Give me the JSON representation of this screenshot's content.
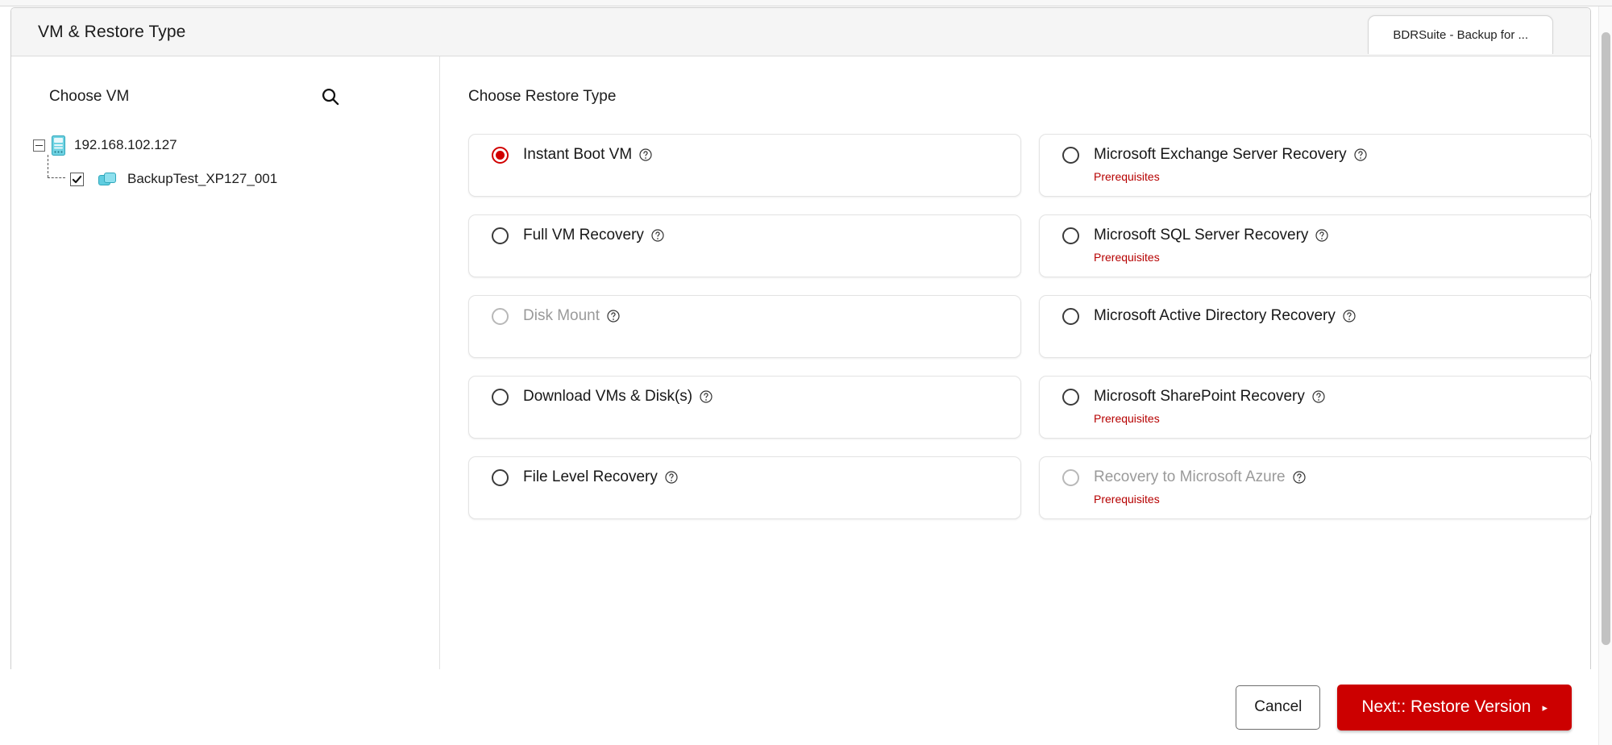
{
  "window": {
    "title": "VM & Restore Type",
    "browser_tab_label": "BDRSuite - Backup for ..."
  },
  "vm_panel": {
    "title": "Choose VM",
    "search_icon": "search-icon",
    "tree": {
      "root": {
        "label": "192.168.102.127",
        "icon": "server-icon",
        "expander": "minus-box-icon",
        "expanded": true
      },
      "children": [
        {
          "label": "BackupTest_XP127_001",
          "icon": "vm-stack-icon",
          "checked": true
        }
      ]
    }
  },
  "restore_panel": {
    "title": "Choose Restore Type",
    "help_icon": "question-circle-icon",
    "prerequisites_label": "Prerequisites",
    "left_options": [
      {
        "label": "Instant Boot VM",
        "selected": true,
        "disabled": false,
        "prerequisites": false
      },
      {
        "label": "Full VM Recovery",
        "selected": false,
        "disabled": false,
        "prerequisites": false
      },
      {
        "label": "Disk Mount",
        "selected": false,
        "disabled": true,
        "prerequisites": false
      },
      {
        "label": "Download VMs & Disk(s)",
        "selected": false,
        "disabled": false,
        "prerequisites": false
      },
      {
        "label": "File Level Recovery",
        "selected": false,
        "disabled": false,
        "prerequisites": false
      }
    ],
    "right_options": [
      {
        "label": "Microsoft Exchange Server Recovery",
        "selected": false,
        "disabled": false,
        "prerequisites": true
      },
      {
        "label": "Microsoft SQL Server Recovery",
        "selected": false,
        "disabled": false,
        "prerequisites": true
      },
      {
        "label": "Microsoft Active Directory Recovery",
        "selected": false,
        "disabled": false,
        "prerequisites": false
      },
      {
        "label": "Microsoft SharePoint Recovery",
        "selected": false,
        "disabled": false,
        "prerequisites": true
      },
      {
        "label": "Recovery to Microsoft Azure",
        "selected": false,
        "disabled": true,
        "prerequisites": true
      }
    ]
  },
  "footer": {
    "cancel_label": "Cancel",
    "next_label": "Next:: Restore Version",
    "next_caret": "▸"
  },
  "colors": {
    "accent_red": "#cc0000",
    "radio_selected": "#d10000",
    "prerequisites_red": "#b60000",
    "header_bg": "#f5f5f5",
    "tree_icon_cyan": "#4dc3d6"
  }
}
